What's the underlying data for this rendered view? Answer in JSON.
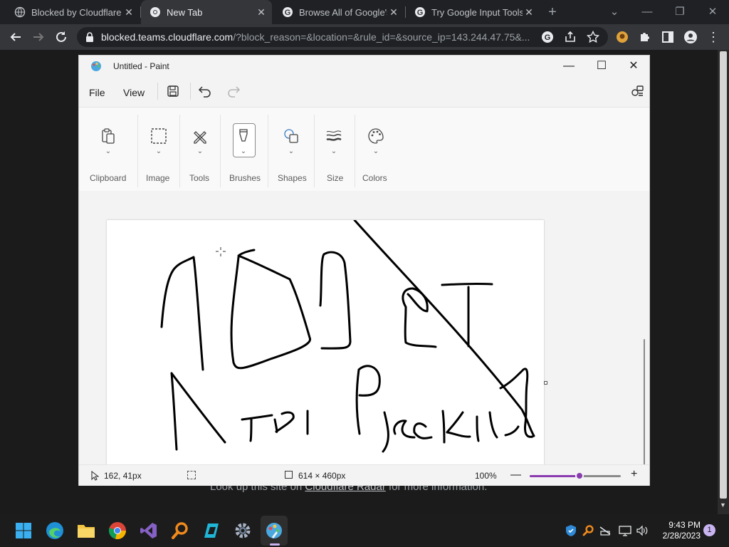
{
  "browser": {
    "tabs": [
      {
        "title": "Blocked by Cloudflare Gateway",
        "active": false
      },
      {
        "title": "New Tab",
        "active": true
      },
      {
        "title": "Browse All of Google's Products",
        "active": false
      },
      {
        "title": "Try Google Input Tools online",
        "active": false
      }
    ],
    "url_host": "blocked.teams.cloudflare.com",
    "url_rest": "/?block_reason=&location=&rule_id=&source_ip=143.244.47.75&..."
  },
  "page_behind": {
    "text_before": "Look up this site on ",
    "link": "Cloudflare Radar",
    "text_after": " for more information."
  },
  "paint": {
    "title": "Untitled - Paint",
    "menu": {
      "file": "File",
      "view": "View"
    },
    "ribbon_groups": [
      "Clipboard",
      "Image",
      "Tools",
      "Brushes",
      "Shapes",
      "Size",
      "Colors"
    ],
    "status": {
      "cursor_pos": "162, 41px",
      "canvas_size": "614 × 460px",
      "zoom": "100%",
      "zoom_level": 0.55
    }
  },
  "taskbar": {
    "time": "9:43 PM",
    "date": "2/28/2023",
    "notification_count": "1"
  },
  "colors": {
    "chrome_dark": "#202124",
    "chrome_toolbar": "#35363a",
    "paint_accent": "#8a3bb0",
    "taskbar": "#1c1c1c"
  }
}
